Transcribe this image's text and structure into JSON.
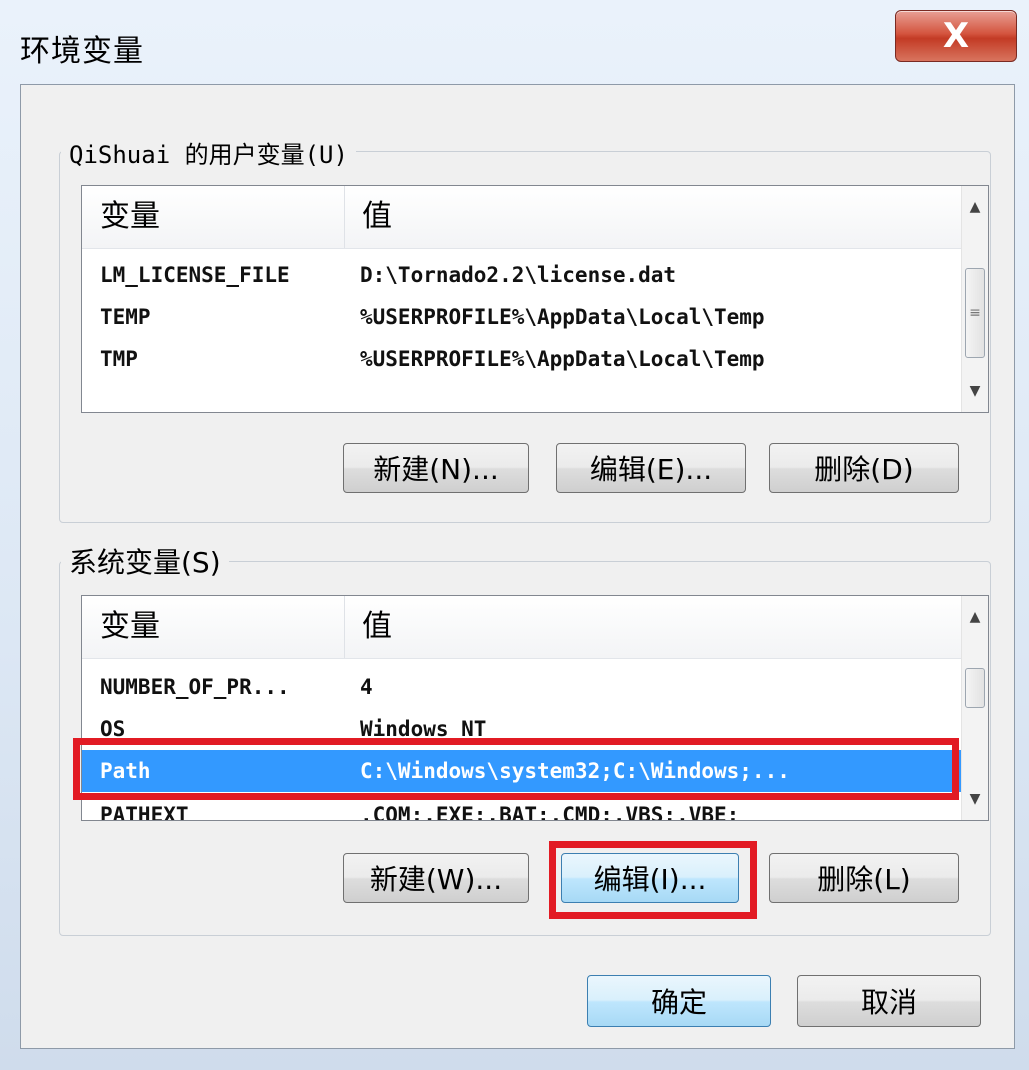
{
  "window": {
    "title": "环境变量",
    "close_glyph": "X"
  },
  "user_vars": {
    "legend": "QiShuai 的用户变量(U)",
    "columns": [
      "变量",
      "值"
    ],
    "rows": [
      {
        "name": "LM_LICENSE_FILE",
        "value": "D:\\Tornado2.2\\license.dat"
      },
      {
        "name": "TEMP",
        "value": "%USERPROFILE%\\AppData\\Local\\Temp"
      },
      {
        "name": "TMP",
        "value": "%USERPROFILE%\\AppData\\Local\\Temp"
      }
    ],
    "buttons": {
      "new": "新建(N)...",
      "edit": "编辑(E)...",
      "delete": "删除(D)"
    }
  },
  "system_vars": {
    "legend": "系统变量(S)",
    "columns": [
      "变量",
      "值"
    ],
    "rows": [
      {
        "name": "NUMBER_OF_PR...",
        "value": "4"
      },
      {
        "name": "OS",
        "value": "Windows_NT"
      },
      {
        "name": "Path",
        "value": "C:\\Windows\\system32;C:\\Windows;...",
        "selected": true
      },
      {
        "name": "PATHEXT",
        "value": ".COM;.EXE;.BAT;.CMD;.VBS;.VBE;"
      }
    ],
    "buttons": {
      "new": "新建(W)...",
      "edit": "编辑(I)...",
      "delete": "删除(L)"
    }
  },
  "dialog_buttons": {
    "ok": "确定",
    "cancel": "取消"
  },
  "colors": {
    "selection": "#3399ff",
    "annotation": "#e21b24"
  },
  "icons": {
    "scroll_up": "▲",
    "scroll_down": "▼",
    "grip": "≡"
  }
}
